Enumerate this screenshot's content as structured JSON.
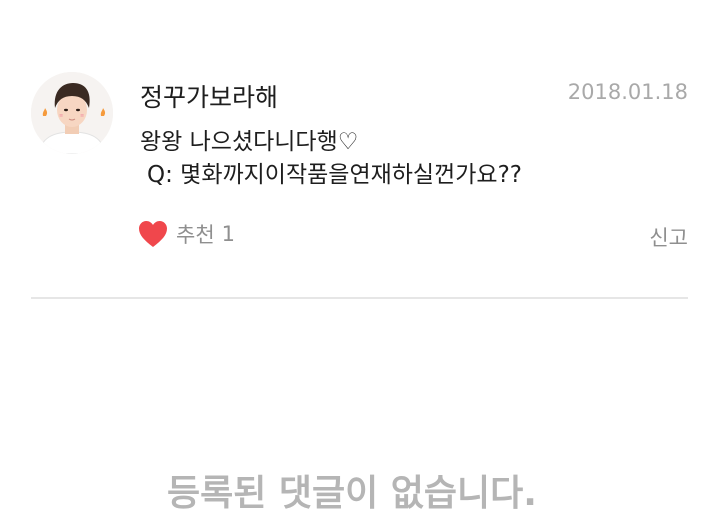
{
  "comment": {
    "author": "정꾸가보라해",
    "date": "2018.01.18",
    "body_line1": "왕왕 나으셨다니다행♡",
    "body_line2": "Q: 몇화까지이작품을연재하실껀가요??",
    "like_icon": "heart-icon",
    "like_label": "추천",
    "like_count": "1",
    "report_label": "신고"
  },
  "empty_state": {
    "message": "등록된 댓글이 없습니다."
  },
  "colors": {
    "heart": "#f0474c",
    "secondary_text": "#8f8f8f",
    "date_text": "#a9a9a9",
    "empty_text": "#b5b5b5",
    "divider": "#e6e6e6"
  }
}
